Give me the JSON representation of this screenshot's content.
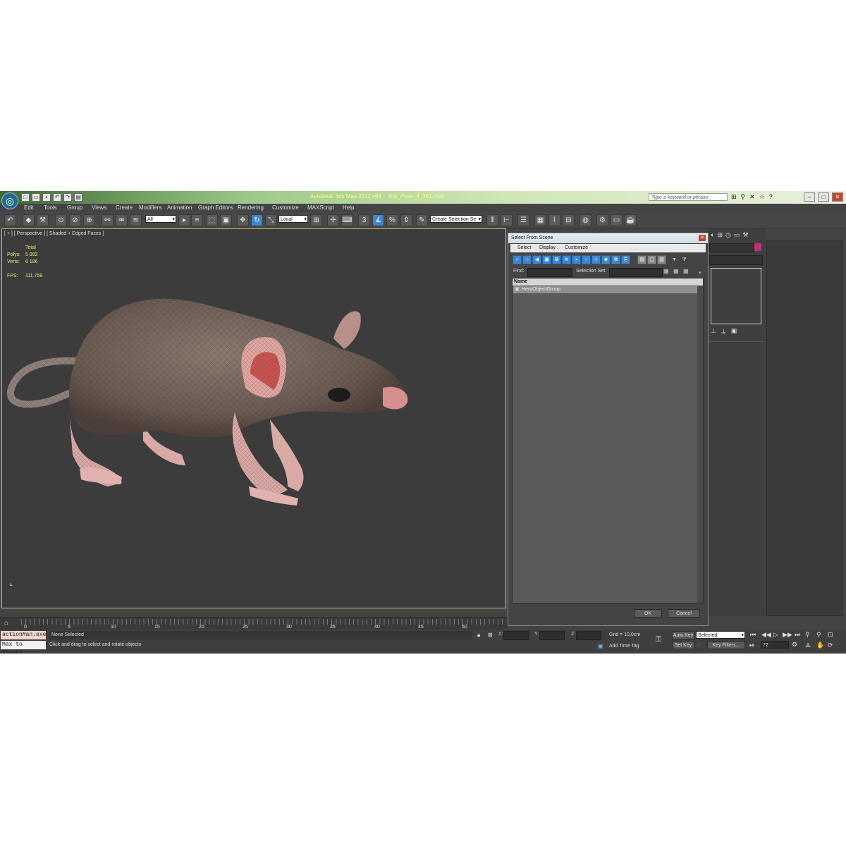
{
  "app": {
    "title": "Autodesk 3ds Max  2012 x64",
    "file": "Rat_Pose_4_361.max",
    "search_placeholder": "Type a keyword or phrase"
  },
  "menu": [
    "Edit",
    "Tools",
    "Group",
    "Views",
    "Create",
    "Modifiers",
    "Animation",
    "Graph Editors",
    "Rendering",
    "Customize",
    "MAXScript",
    "Help"
  ],
  "toolbar": {
    "selection_filter": "All",
    "ref_coord": "Local",
    "named_selection": "Create Selection Se",
    "snap_label": "3"
  },
  "viewport": {
    "label": "[ + ] [ Perspective ] [ Shaded + Edged Faces ]",
    "stats": {
      "total_label": "Total",
      "polys_label": "Polys:",
      "polys_value": "5 992",
      "verts_label": "Verts:",
      "verts_value": "6 186",
      "fps_label": "FPS:",
      "fps_value": "111.759"
    }
  },
  "timeline": {
    "ticks": [
      "0",
      "5",
      "10",
      "15",
      "20",
      "25",
      "30",
      "35",
      "40",
      "45",
      "50"
    ]
  },
  "status": {
    "listener1": "actionMan.exe",
    "listener2": "Max to Physcs",
    "selection": "None Selected",
    "prompt": "Click and drag to select and rotate objects",
    "x_label": "X:",
    "y_label": "Y:",
    "z_label": "Z:",
    "grid": "Grid = 10,0cm",
    "add_time_tag": "Add Time Tag",
    "auto_key": "Auto Key",
    "set_key": "Set Key",
    "key_mode": "Selected",
    "key_filters": "Key Filters...",
    "frame": "72"
  },
  "dialog": {
    "title": "Select From Scene",
    "menu": [
      "Select",
      "Display",
      "Customize"
    ],
    "find_label": "Find:",
    "selection_set_label": "Selection Set:",
    "column_name": "Name",
    "items": [
      "HeroObjectGroup"
    ],
    "ok": "OK",
    "cancel": "Cancel"
  },
  "colors": {
    "accent_blue": "#3f86d0",
    "viewport_border": "#d6c27a",
    "stats_yellow": "#f0e76a",
    "title_text": "#ffff70"
  }
}
